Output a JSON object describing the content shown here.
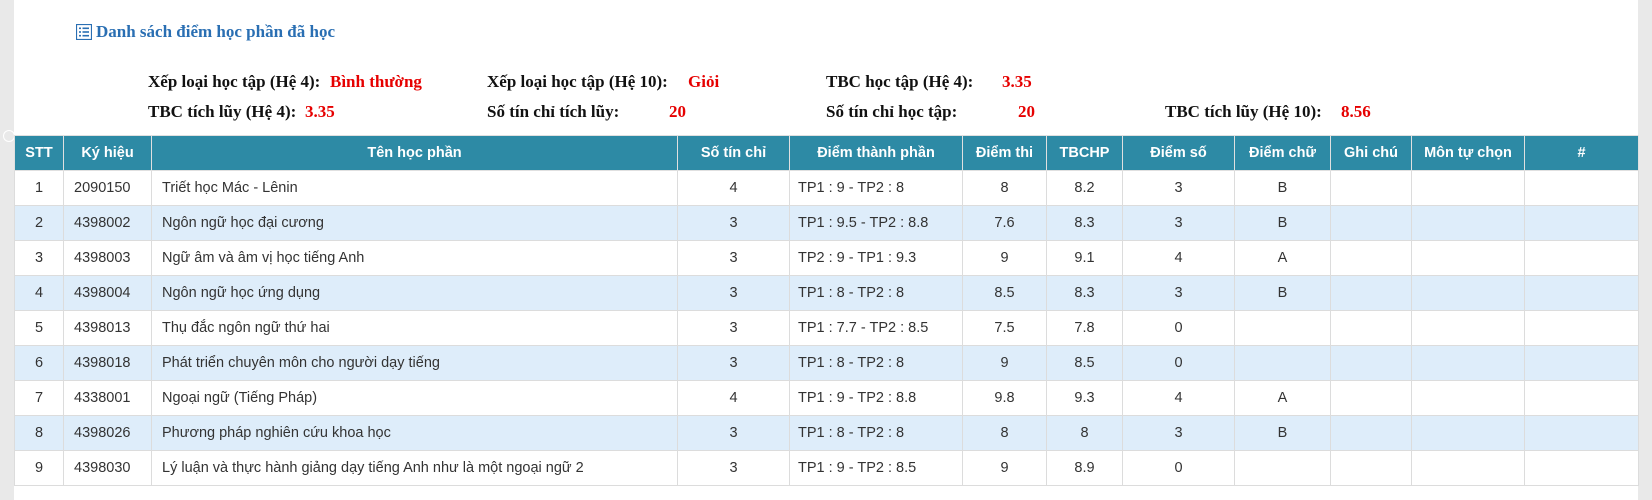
{
  "heading": "Danh sách điểm học phần đã học",
  "summary": {
    "xep_loai_he4_label": "Xếp loại học tập (Hệ 4):",
    "xep_loai_he4_value": "Bình thường",
    "xep_loai_he10_label": "Xếp loại học tập (Hệ 10):",
    "xep_loai_he10_value": "Giỏi",
    "tbc_hoc_tap_he4_label": "TBC học tập (Hệ 4):",
    "tbc_hoc_tap_he4_value": "3.35",
    "tbc_tich_luy_he4_label": "TBC tích lũy (Hệ 4):",
    "tbc_tich_luy_he4_value": "3.35",
    "so_tin_chi_tich_luy_label": "Số tín chỉ tích lũy:",
    "so_tin_chi_tich_luy_value": "20",
    "so_tin_chi_hoc_tap_label": "Số tín chỉ học tập:",
    "so_tin_chi_hoc_tap_value": "20",
    "tbc_tich_luy_he10_label": "TBC tích lũy (Hệ 10):",
    "tbc_tich_luy_he10_value": "8.56"
  },
  "table": {
    "headers": [
      "STT",
      "Ký hiệu",
      "Tên học phần",
      "Số tín chỉ",
      "Điểm thành phần",
      "Điểm thi",
      "TBCHP",
      "Điểm số",
      "Điểm chữ",
      "Ghi chú",
      "Môn tự chọn",
      "#"
    ],
    "rows": [
      [
        "1",
        "2090150",
        "Triết học Mác - Lênin",
        "4",
        "TP1 : 9 - TP2 : 8",
        "8",
        "8.2",
        "3",
        "B",
        "",
        "",
        ""
      ],
      [
        "2",
        "4398002",
        "Ngôn ngữ học đại cương",
        "3",
        "TP1 : 9.5 - TP2 : 8.8",
        "7.6",
        "8.3",
        "3",
        "B",
        "",
        "",
        ""
      ],
      [
        "3",
        "4398003",
        "Ngữ âm và âm vị học tiếng Anh",
        "3",
        "TP2 : 9 - TP1 : 9.3",
        "9",
        "9.1",
        "4",
        "A",
        "",
        "",
        ""
      ],
      [
        "4",
        "4398004",
        "Ngôn ngữ học ứng dụng",
        "3",
        "TP1 : 8 - TP2 : 8",
        "8.5",
        "8.3",
        "3",
        "B",
        "",
        "",
        ""
      ],
      [
        "5",
        "4398013",
        "Thụ đắc ngôn ngữ thứ hai",
        "3",
        "TP1 : 7.7 - TP2 : 8.5",
        "7.5",
        "7.8",
        "0",
        "",
        "",
        "",
        ""
      ],
      [
        "6",
        "4398018",
        "Phát triển chuyên môn cho người dạy tiếng",
        "3",
        "TP1 : 8 - TP2 : 8",
        "9",
        "8.5",
        "0",
        "",
        "",
        "",
        ""
      ],
      [
        "7",
        "4338001",
        "Ngoại ngữ (Tiếng Pháp)",
        "4",
        "TP1 : 9 - TP2 : 8.8",
        "9.8",
        "9.3",
        "4",
        "A",
        "",
        "",
        ""
      ],
      [
        "8",
        "4398026",
        "Phương pháp nghiên cứu khoa học",
        "3",
        "TP1 : 8 - TP2 : 8",
        "8",
        "8",
        "3",
        "B",
        "",
        "",
        ""
      ],
      [
        "9",
        "4398030",
        "Lý luận và thực hành giảng dạy tiếng Anh như là một ngoại ngữ 2",
        "3",
        "TP1 : 9 - TP2 : 8.5",
        "9",
        "8.9",
        "0",
        "",
        "",
        "",
        ""
      ]
    ]
  }
}
